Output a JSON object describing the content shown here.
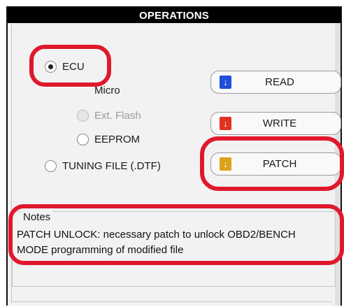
{
  "header": {
    "title": "OPERATIONS"
  },
  "radios": {
    "ecu": "ECU",
    "micro": "Micro",
    "ext_flash": "Ext. Flash",
    "eeprom": "EEPROM",
    "tuning_file": "TUNING FILE (.DTF)"
  },
  "buttons": {
    "read": {
      "label": "READ",
      "icon": "download-arrow-icon",
      "color": "#1f4fd8"
    },
    "write": {
      "label": "WRITE",
      "icon": "download-arrow-icon",
      "color": "#e0321e"
    },
    "patch": {
      "label": "PATCH",
      "icon": "download-arrow-icon",
      "color": "#d9a21b"
    }
  },
  "notes": {
    "legend": "Notes",
    "line1": "PATCH UNLOCK: necessary patch to unlock OBD2/BENCH",
    "line2": "MODE programming of modified file"
  },
  "colors": {
    "highlight": "#e0182b",
    "header_bg": "#000000"
  }
}
